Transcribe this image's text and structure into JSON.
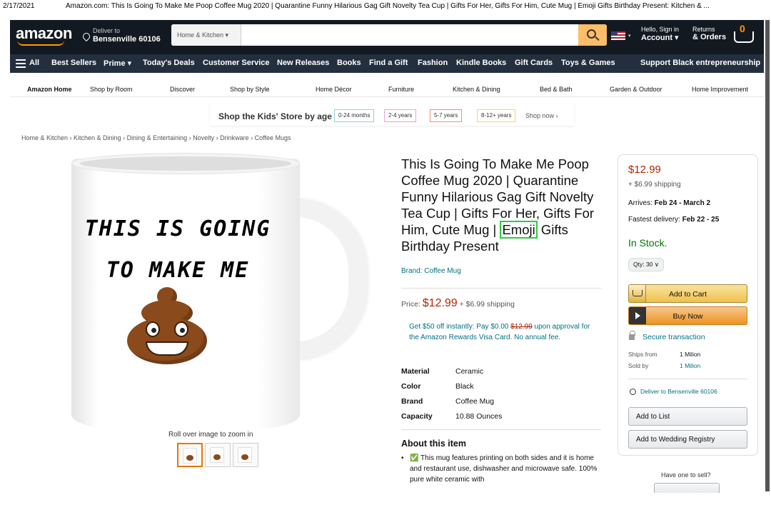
{
  "print_header": {
    "date": "2/17/2021",
    "title": "Amazon.com: This Is Going To Make Me Poop Coffee Mug 2020 | Quarantine Funny Hilarious Gag Gift Novelty Tea Cup | Gifts For Her, Gifts For Him, Cute Mug | Emoji Gifts Birthday Present: Kitchen & ..."
  },
  "navbar": {
    "logo": "amazon",
    "deliver_to": "Deliver to",
    "location": "Bensenville 60106",
    "search_category": "Home & Kitchen ▾",
    "search_value": "",
    "account_line1": "Hello, Sign in",
    "account_line2": "Account ▾",
    "returns_line1": "Returns",
    "returns_line2": "& Orders",
    "cart_count": "0"
  },
  "subnav": {
    "all": "All",
    "items": [
      "Best Sellers",
      "Prime ▾",
      "Today's Deals",
      "Customer Service",
      "New Releases",
      "Books",
      "Find a Gift",
      "Fashion",
      "Kindle Books",
      "Gift Cards",
      "Toys & Games"
    ],
    "promo": "Support Black entrepreneurship"
  },
  "storenav": {
    "items": [
      "Amazon Home",
      "Shop by Room",
      "Discover",
      "Shop by Style",
      "Home Décor",
      "Furniture",
      "Kitchen & Dining",
      "Bed & Bath",
      "Garden & Outdoor",
      "Home Improvement"
    ]
  },
  "kids_banner": {
    "title": "Shop the Kids' Store by age",
    "pills": [
      "0-24 months",
      "2-4 years",
      "5-7 years",
      "8-12+ years"
    ],
    "pill_colors": [
      "#8dd3e0",
      "#e7a4d4",
      "#f0907a",
      "#f5d562"
    ],
    "shop_now": "Shop now ›"
  },
  "breadcrumb": "Home & Kitchen › Kitchen & Dining › Dining & Entertaining › Novelty › Drinkware › Coffee Mugs",
  "image": {
    "mug_text_line1": "THIS IS GOING",
    "mug_text_line2": "TO MAKE ME",
    "zoom_hint": "Roll over image to zoom in"
  },
  "product": {
    "title_before": "This Is Going To Make Me Poop Coffee Mug 2020 | Quarantine Funny Hilarious Gag Gift Novelty Tea Cup | Gifts For Her, Gifts For Him, Cute Mug | ",
    "title_highlight": "Emoji",
    "title_after": " Gifts Birthday Present",
    "brand": "Brand: Coffee Mug",
    "price_label": "Price:",
    "price": "$12.99",
    "shipping": "+ $6.99 shipping",
    "offer_before": "Get $50 off instantly: Pay $0.00 ",
    "offer_strike": "$12.99",
    "offer_after": " upon approval for the Amazon Rewards Visa Card. No annual fee.",
    "specs": [
      {
        "k": "Material",
        "v": "Ceramic"
      },
      {
        "k": "Color",
        "v": "Black"
      },
      {
        "k": "Brand",
        "v": "Coffee Mug"
      },
      {
        "k": "Capacity",
        "v": "10.88 Ounces"
      }
    ],
    "about_heading": "About this item",
    "about_bullet": "✅ This mug features printing on both sides and it is home and restaurant use, dishwasher and microwave safe. 100% pure white ceramic with"
  },
  "buybox": {
    "price": "$12.99",
    "shipping": "+ $6.99 shipping",
    "arrives_label": "Arrives: ",
    "arrives": "Feb 24 - March 2",
    "fastest_label": "Fastest delivery: ",
    "fastest": "Feb 22 - 25",
    "stock": "In Stock.",
    "qty": "Qty: 30 ∨",
    "add_to_cart": "Add to Cart",
    "buy_now": "Buy Now",
    "secure": "Secure transaction",
    "ships_from_label": "Ships from",
    "ships_from": "1 Milion",
    "sold_by_label": "Sold by",
    "sold_by": "1 Milion",
    "deliver_to": "Deliver to Bensenville 60106",
    "add_to_list": "Add to List",
    "add_to_registry": "Add to Wedding Registry"
  },
  "sell": {
    "text": "Have one to sell?"
  }
}
